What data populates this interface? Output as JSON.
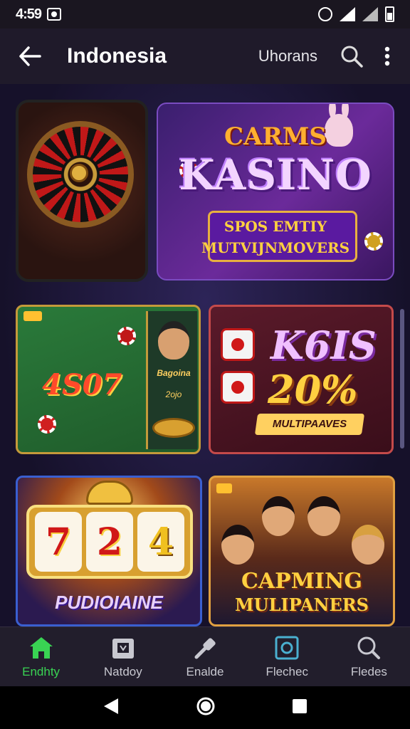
{
  "status_bar": {
    "time": "4:59"
  },
  "app_bar": {
    "title": "Indonesia",
    "subtitle": "Uhorans"
  },
  "banners": {
    "kasino": {
      "top": "CARMS",
      "main": "KASINO",
      "line1": "SPOS EMTIY",
      "line2": "MUTVIJNMOVERS"
    },
    "poker": {
      "amount": "4S07",
      "side_name": "Bagoina",
      "side_sub": "2ojo"
    },
    "dice": {
      "big": "K6IS",
      "percent": "20%",
      "plate": "MULTIPAAVES"
    },
    "slot": {
      "reel1": "7",
      "reel2": "2",
      "reel3": "4",
      "name": "PUDIOIAINE"
    },
    "people": {
      "title": "CAPMING",
      "subtitle": "MULIPANERS"
    }
  },
  "bottom_nav": [
    {
      "label": "Endhty",
      "icon": "home-icon",
      "active": true
    },
    {
      "label": "Natdoy",
      "icon": "store-icon",
      "active": false
    },
    {
      "label": "Enalde",
      "icon": "tool-icon",
      "active": false
    },
    {
      "label": "Flechec",
      "icon": "wallet-icon",
      "active": false
    },
    {
      "label": "Fledes",
      "icon": "search-icon",
      "active": false
    }
  ],
  "colors": {
    "accent_active": "#39d353",
    "app_bar_bg": "#1f1a2a",
    "nav_bg": "#221e2c"
  }
}
